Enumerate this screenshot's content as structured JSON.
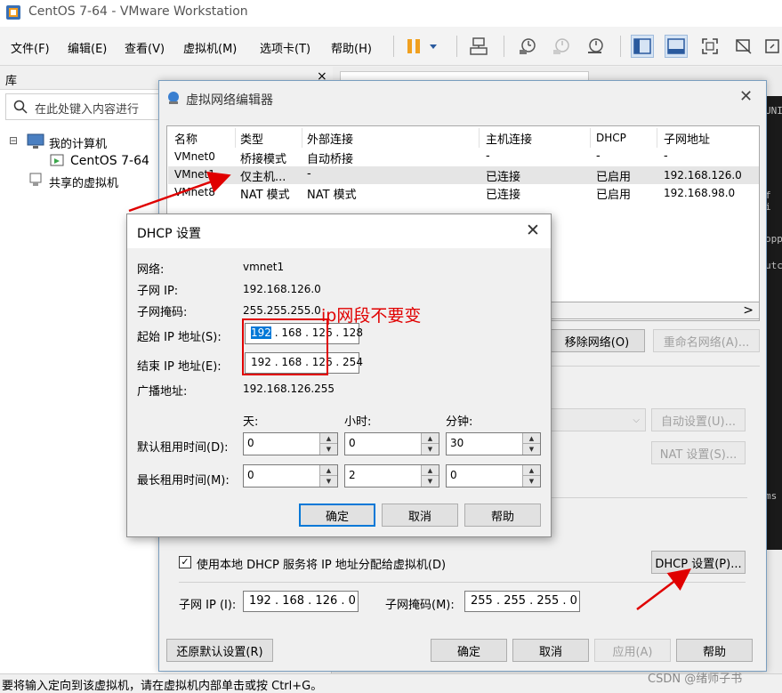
{
  "window": {
    "title": "CentOS 7-64 - VMware Workstation"
  },
  "menu": [
    {
      "label": "文件(F)",
      "underline": "F"
    },
    {
      "label": "编辑(E)",
      "underline": "E"
    },
    {
      "label": "查看(V)",
      "underline": "V"
    },
    {
      "label": "虚拟机(M)",
      "underline": "M"
    },
    {
      "label": "选项卡(T)",
      "underline": "T"
    },
    {
      "label": "帮助(H)",
      "underline": "H"
    }
  ],
  "toolbar_icons": [
    "pause-icon",
    "dropdown-icon",
    "network-icon",
    "snapshot-icon",
    "snapshot-revert-icon",
    "snapshot-manager-icon",
    "sidebar-toggle-icon",
    "thumbnail-bar-icon",
    "fullscreen-icon",
    "unity-icon",
    "more-icon"
  ],
  "library": {
    "title": "库",
    "close": "×",
    "search_placeholder": "在此处键入内容进行",
    "tree": [
      {
        "label": "我的计算机",
        "toggle": "⊟"
      },
      {
        "label": "CentOS 7-64"
      },
      {
        "label": "共享的虚拟机"
      }
    ]
  },
  "terminal_fragments": [
    "UNI",
    "f i",
    "opp",
    "utc",
    "ms"
  ],
  "status_bar": "要将输入定向到该虚拟机，请在虚拟机内部单击或按 Ctrl+G。",
  "watermark": "CSDN @绪师子书",
  "network_editor": {
    "title": "虚拟网络编辑器",
    "columns": [
      "名称",
      "类型",
      "外部连接",
      "主机连接",
      "DHCP",
      "子网地址"
    ],
    "rows": [
      [
        "VMnet0",
        "桥接模式",
        "自动桥接",
        "-",
        "-",
        "-"
      ],
      [
        "VMnet1",
        "仅主机...",
        "-",
        "已连接",
        "已启用",
        "192.168.126.0"
      ],
      [
        "VMnet8",
        "NAT 模式",
        "NAT 模式",
        "已连接",
        "已启用",
        "192.168.98.0"
      ]
    ],
    "scroll_right": ">",
    "buttons": {
      "remove_network": "移除网络(O)",
      "rename_network": "重命名网络(A)...",
      "auto_settings": "自动设置(U)...",
      "nat_settings": "NAT 设置(S)...",
      "dhcp_settings": "DHCP 设置(P)...",
      "restore_defaults": "还原默认设置(R)",
      "ok": "确定",
      "cancel": "取消",
      "apply": "应用(A)",
      "help": "帮助"
    },
    "use_dhcp": {
      "label": "使用本地 DHCP 服务将 IP 地址分配给虚拟机(D)",
      "checked": true
    },
    "subnet_ip_label": "子网 IP (I):",
    "subnet_ip": "192 . 168 . 126 . 0",
    "subnet_mask_label": "子网掩码(M):",
    "subnet_mask": "255 . 255 . 255 . 0"
  },
  "dhcp_dialog": {
    "title": "DHCP 设置",
    "close": "✕",
    "network_label": "网络:",
    "network_value": "vmnet1",
    "subnet_ip_label": "子网 IP:",
    "subnet_ip_value": "192.168.126.0",
    "subnet_mask_label": "子网掩码:",
    "subnet_mask_value": "255.255.255.0",
    "start_ip_label": "起始 IP 地址(S):",
    "start_ip": {
      "part1": "192",
      "rest": " . 168 . 126 . 128"
    },
    "end_ip_label": "结束 IP 地址(E):",
    "end_ip": "192 . 168 . 126 . 254",
    "broadcast_label": "广播地址:",
    "broadcast_value": "192.168.126.255",
    "headers": {
      "days": "天:",
      "hours": "小时:",
      "minutes": "分钟:"
    },
    "default_lease_label": "默认租用时间(D):",
    "default_lease": {
      "days": "0",
      "hours": "0",
      "minutes": "30"
    },
    "max_lease_label": "最长租用时间(M):",
    "max_lease": {
      "days": "0",
      "hours": "2",
      "minutes": "0"
    },
    "buttons": {
      "ok": "确定",
      "cancel": "取消",
      "help": "帮助"
    }
  },
  "annotation": {
    "text": "ip网段不要变",
    "color": "#e00000"
  }
}
